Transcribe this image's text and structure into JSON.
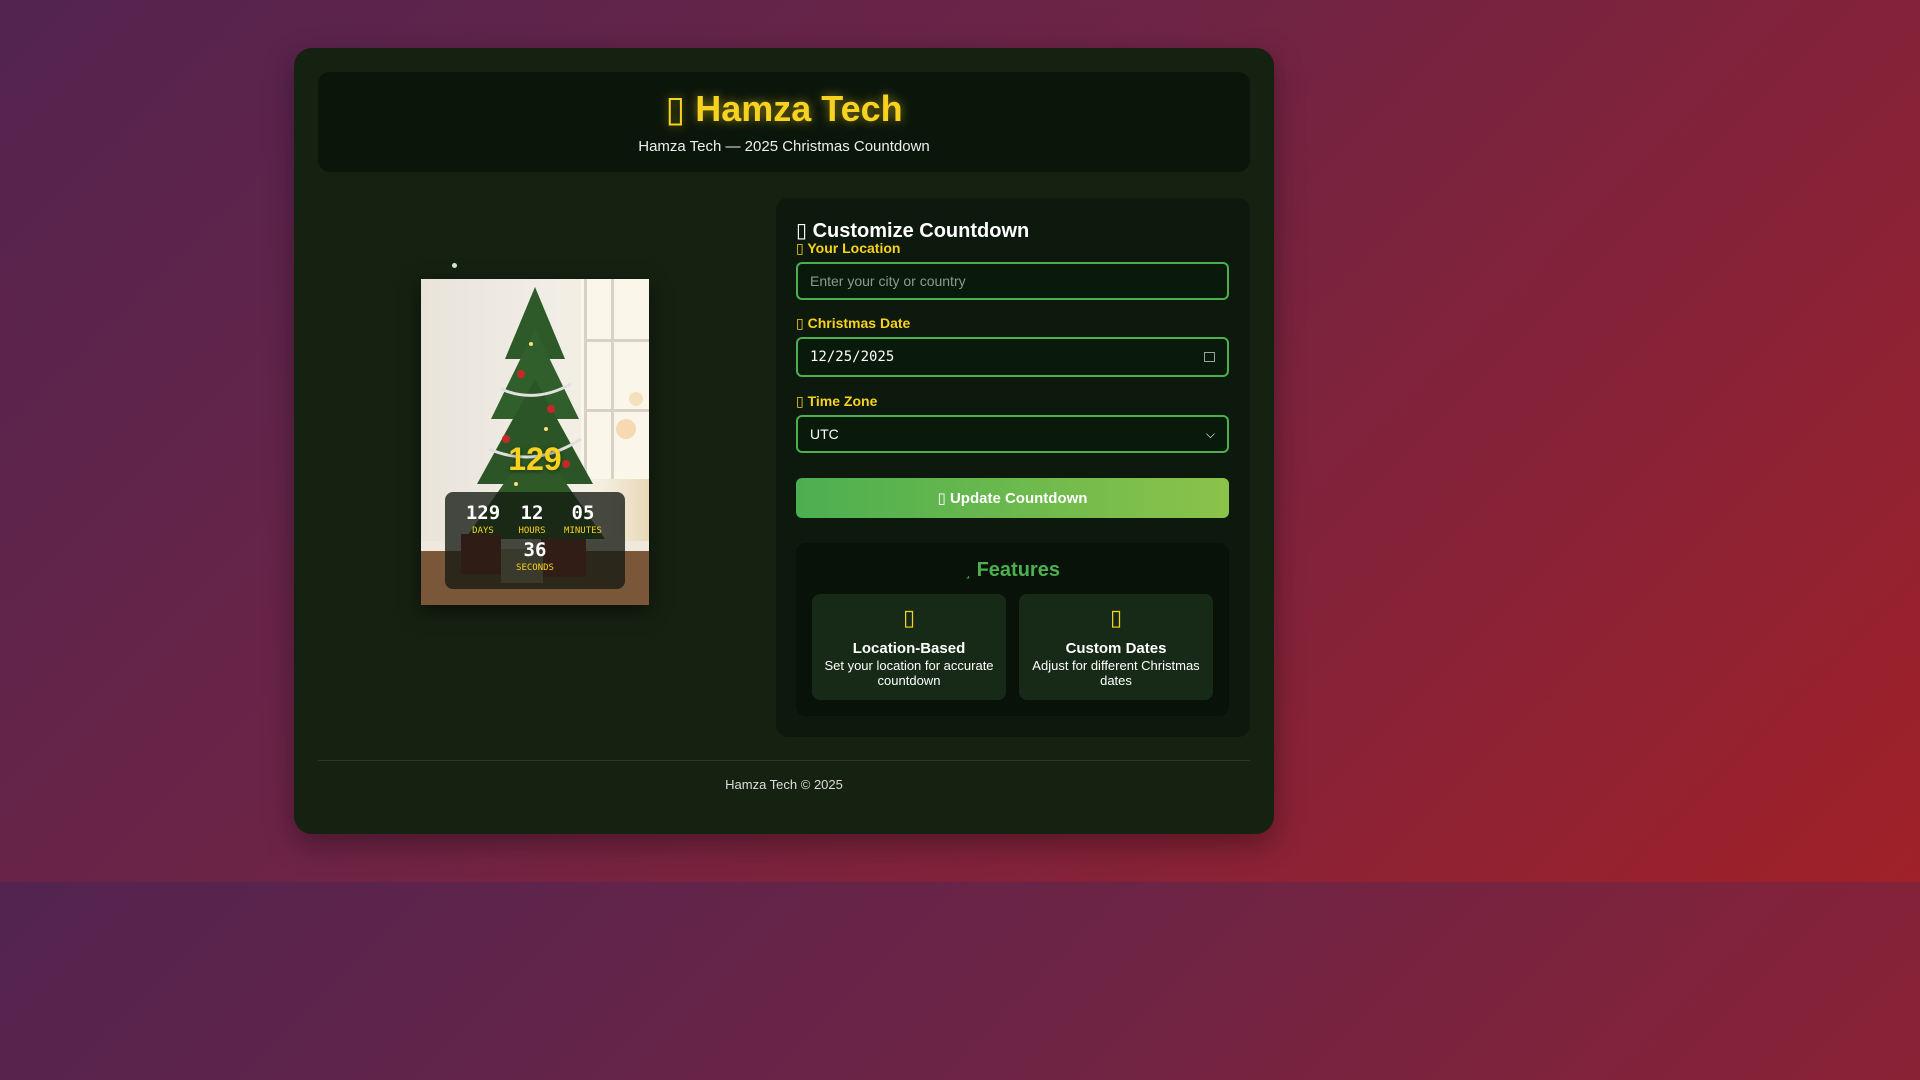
{
  "header": {
    "title": "Hamza Tech",
    "title_icon": "tree-icon",
    "subtitle": "Hamza Tech — 2025 Christmas Countdown"
  },
  "photo": {
    "big_days": "129",
    "timer": [
      {
        "value": "129",
        "label": "DAYS"
      },
      {
        "value": "12",
        "label": "HOURS"
      },
      {
        "value": "05",
        "label": "MINUTES"
      },
      {
        "value": "36",
        "label": "SECONDS"
      }
    ]
  },
  "panel": {
    "title": "Customize Countdown",
    "location": {
      "label": "Your Location",
      "placeholder": "Enter your city or country",
      "value": ""
    },
    "date": {
      "label": "Christmas Date",
      "value": "12/25/2025"
    },
    "timezone": {
      "label": "Time Zone",
      "value": "UTC"
    },
    "update_button": "Update Countdown"
  },
  "features": {
    "title": "Features",
    "items": [
      {
        "title": "Location-Based",
        "desc": "Set your location for accurate countdown",
        "icon": "map-pin-icon"
      },
      {
        "title": "Custom Dates",
        "desc": "Adjust for different Christmas dates",
        "icon": "calendar-icon"
      }
    ]
  },
  "footer": {
    "text": "Hamza Tech © 2025"
  },
  "colors": {
    "accent": "#f7d21e",
    "green": "#4caf50",
    "card": "#152111"
  }
}
